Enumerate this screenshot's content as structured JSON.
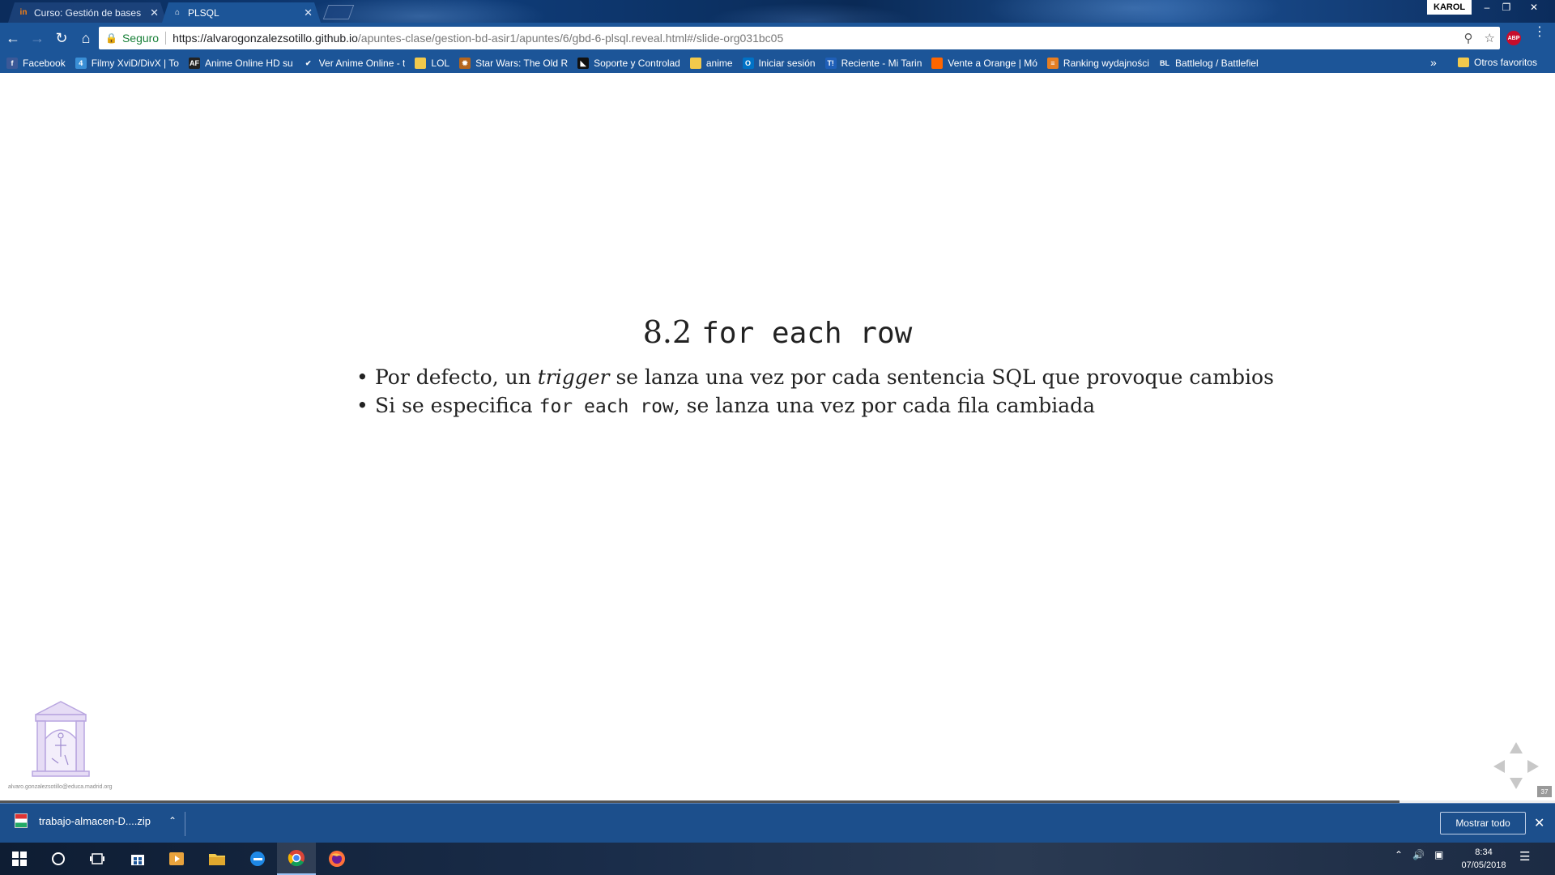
{
  "window": {
    "profile_name": "KAROL",
    "controls": {
      "minimize": "–",
      "restore": "❐",
      "close": "✕"
    }
  },
  "tabs": [
    {
      "label": "Curso: Gestión de bases",
      "favicon": "in",
      "active": false,
      "close": "✕"
    },
    {
      "label": "PLSQL",
      "favicon": "⌂",
      "active": true,
      "close": "✕"
    }
  ],
  "addressbar": {
    "secure_label": "Seguro",
    "url_host": "https://alvarogonzalezsotillo.github.io",
    "url_path": "/apuntes-clase/gestion-bd-asir1/apuntes/6/gbd-6-plsql.reveal.html#/slide-org031bc05",
    "adblock_label": "ABP"
  },
  "bookmarks": [
    {
      "label": "Facebook",
      "icon": "f",
      "color": "#3b5998"
    },
    {
      "label": "Filmy XviD/DivX | To",
      "icon": "4",
      "color": "#3a8fd6"
    },
    {
      "label": "Anime Online HD su",
      "icon": "AF",
      "color": "#222222"
    },
    {
      "label": "Ver Anime Online - t",
      "icon": "✔",
      "color": "#1c5598"
    },
    {
      "label": "LOL",
      "icon": "",
      "color": "#f2c94c"
    },
    {
      "label": "Star Wars: The Old R",
      "icon": "✹",
      "color": "#b5651d"
    },
    {
      "label": "Soporte y Controlad",
      "icon": "◣",
      "color": "#111111"
    },
    {
      "label": "anime",
      "icon": "",
      "color": "#f2c94c"
    },
    {
      "label": "Iniciar sesión",
      "icon": "O",
      "color": "#0072c6"
    },
    {
      "label": "Reciente - Mi Tarin",
      "icon": "T!",
      "color": "#1f5fb8"
    },
    {
      "label": "Vente a Orange | Mó",
      "icon": "",
      "color": "#ff6600"
    },
    {
      "label": "Ranking wydajności",
      "icon": "≡",
      "color": "#e67e22"
    },
    {
      "label": "Battlelog / Battlefiel",
      "icon": "BL",
      "color": "#1c5598"
    }
  ],
  "bookmarks_more": "»",
  "bookmarks_other": "Otros favoritos",
  "slide": {
    "title_number": "8.2",
    "title_code": "for each row",
    "bullet1": {
      "before": "Por defecto, un ",
      "em": "trigger",
      "after": " se lanza una vez por cada sentencia SQL que provoque cambios"
    },
    "bullet2": {
      "before": "Si se especifica ",
      "code": "for each row",
      "after": ", se lanza una vez por cada fila cambiada"
    },
    "author_email": "alvaro.gonzalezsotillo@educa.madrid.org",
    "slide_number": "37",
    "progress_fraction": 0.9
  },
  "downloads": {
    "file_name": "trabajo-almacen-D....zip",
    "show_all": "Mostrar todo",
    "close": "✕"
  },
  "taskbar": {
    "time": "8:34",
    "date": "07/05/2018"
  }
}
